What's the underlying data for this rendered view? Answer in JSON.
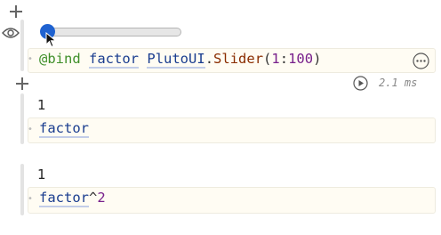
{
  "cell1": {
    "code": {
      "macro": "@bind",
      "var": "factor",
      "module": "PlutoUI",
      "dot": ".",
      "func": "Slider",
      "open": "(",
      "start": "1",
      "colon": ":",
      "end": "100",
      "close": ")"
    },
    "slider_value_fraction": 0.0,
    "runtime": "2.1 ms"
  },
  "cell2": {
    "output": "1",
    "code_var": "factor"
  },
  "cell3": {
    "output": "1",
    "code_var": "factor",
    "code_op": "^",
    "code_num": "2"
  },
  "icons": {
    "add": "plus-icon",
    "visibility": "eye-icon",
    "more": "ellipsis-circle-icon",
    "run": "play-circle-icon",
    "cursor": "arrow-cursor-icon"
  },
  "colors": {
    "slider_thumb": "#1f62d0",
    "code_bg": "#fffcf3",
    "keyword": "#3f8f29",
    "variable": "#1a3d8f",
    "function": "#8a2d00",
    "number": "#78208c"
  }
}
